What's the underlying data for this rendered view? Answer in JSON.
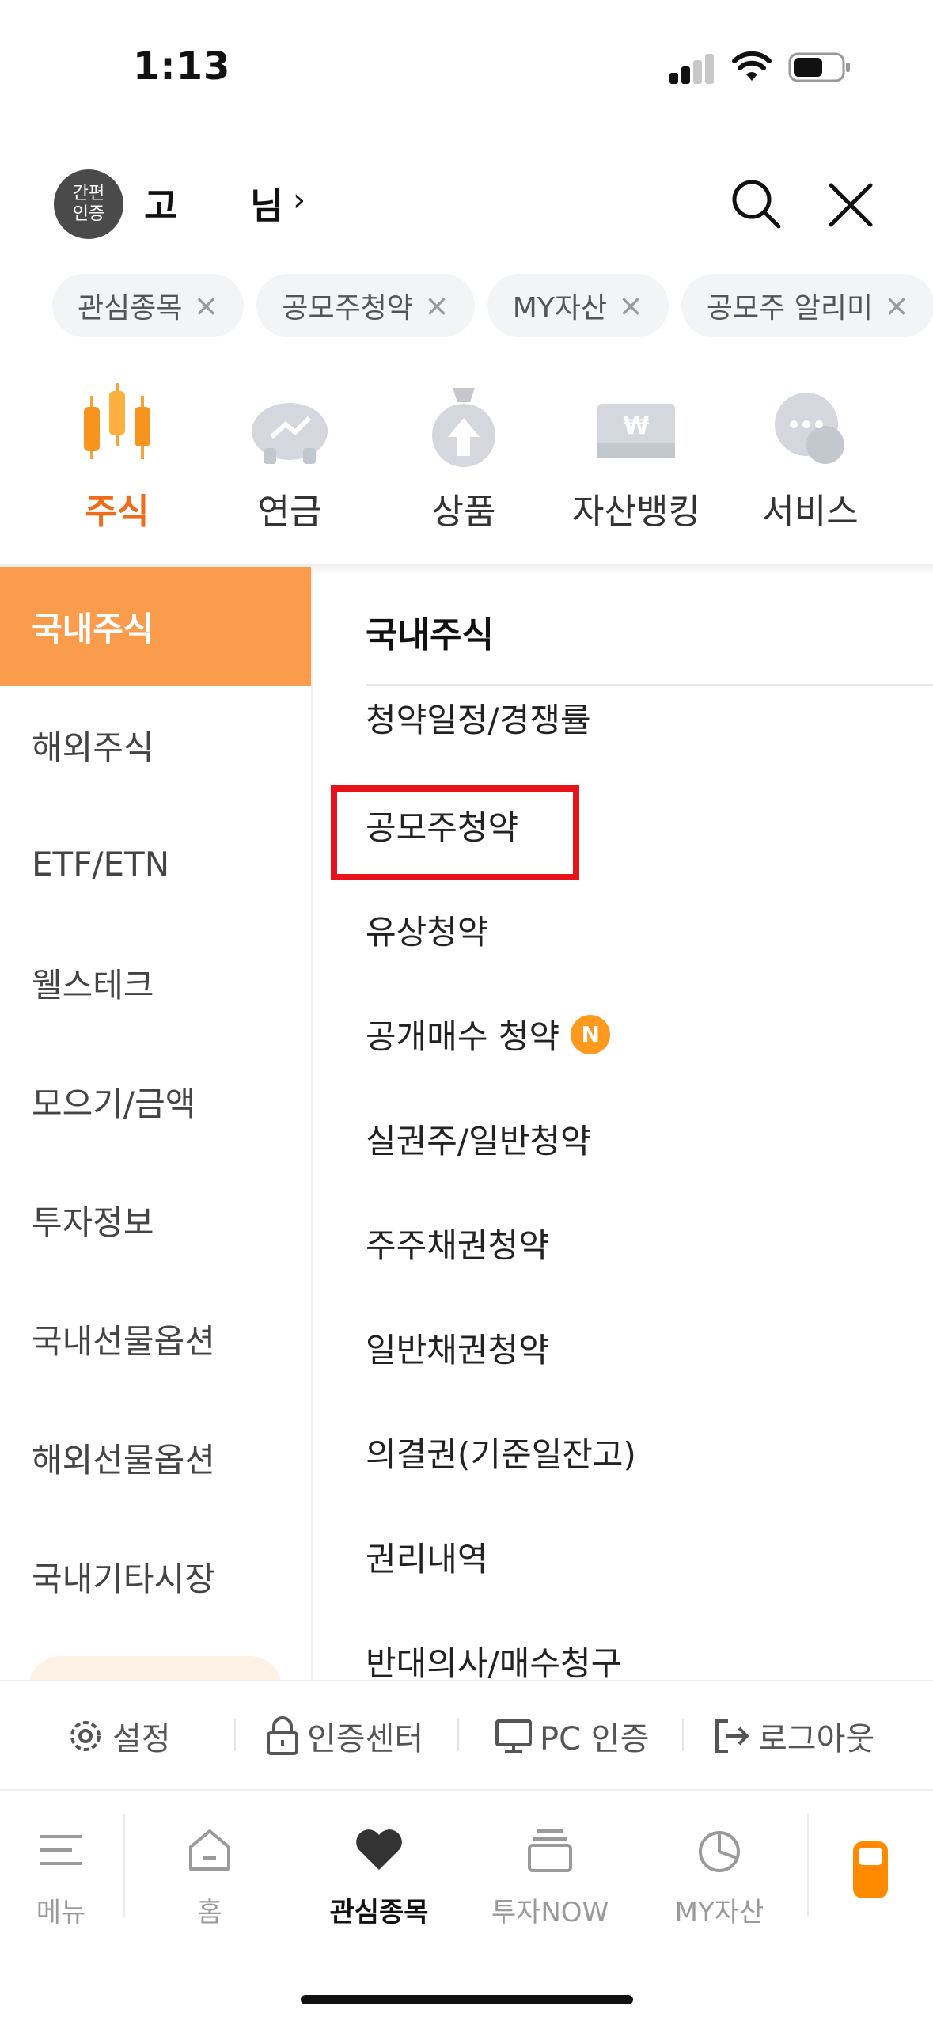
{
  "status_bar": {
    "time": "1:13"
  },
  "header": {
    "auth_badge_line1": "간편",
    "auth_badge_line2": "인증",
    "user_name": "고",
    "user_suffix": "님",
    "chevron": "›"
  },
  "chips": [
    {
      "label": "관심종목"
    },
    {
      "label": "공모주청약"
    },
    {
      "label": "MY자산"
    },
    {
      "label": "공모주 알리미"
    }
  ],
  "categories": [
    {
      "label": "주식",
      "icon": "candlestick-icon",
      "active": true
    },
    {
      "label": "연금",
      "icon": "piggy-bank-icon"
    },
    {
      "label": "상품",
      "icon": "money-bag-icon"
    },
    {
      "label": "자산뱅킹",
      "icon": "won-card-icon"
    },
    {
      "label": "서비스",
      "icon": "chat-bubble-icon"
    }
  ],
  "left_nav": [
    {
      "label": "국내주식",
      "active": true
    },
    {
      "label": "해외주식"
    },
    {
      "label": "ETF/ETN"
    },
    {
      "label": "웰스테크"
    },
    {
      "label": "모으기/금액"
    },
    {
      "label": "투자정보"
    },
    {
      "label": "국내선물옵션"
    },
    {
      "label": "해외선물옵션"
    },
    {
      "label": "국내기타시장"
    }
  ],
  "right_section": {
    "title": "국내주식",
    "items": [
      {
        "label": "청약일정/경쟁률"
      },
      {
        "label": "공모주청약",
        "highlighted": true
      },
      {
        "label": "유상청약"
      },
      {
        "label": "공개매수 청약",
        "badge": "N"
      },
      {
        "label": "실권주/일반청약"
      },
      {
        "label": "주주채권청약"
      },
      {
        "label": "일반채권청약"
      },
      {
        "label": "의결권(기준일잔고)"
      },
      {
        "label": "권리내역"
      },
      {
        "label": "반대의사/매수청구"
      }
    ]
  },
  "utility_bar": [
    {
      "label": "설정",
      "icon": "gear-icon"
    },
    {
      "label": "인증센터",
      "icon": "lock-icon"
    },
    {
      "label": "PC 인증",
      "icon": "monitor-icon"
    },
    {
      "label": "로그아웃",
      "icon": "logout-icon"
    }
  ],
  "tab_bar": [
    {
      "label": "메뉴",
      "icon": "menu-icon"
    },
    {
      "label": "홈",
      "icon": "home-icon"
    },
    {
      "label": "관심종목",
      "icon": "heart-icon",
      "active": true
    },
    {
      "label": "투자NOW",
      "icon": "stack-icon"
    },
    {
      "label": "MY자산",
      "icon": "pie-chart-icon"
    }
  ],
  "colors": {
    "accent": "#ef6c1a",
    "nav_active": "#fb9c4c",
    "highlight_box": "#e8121a",
    "badge": "#ff9a1f"
  }
}
